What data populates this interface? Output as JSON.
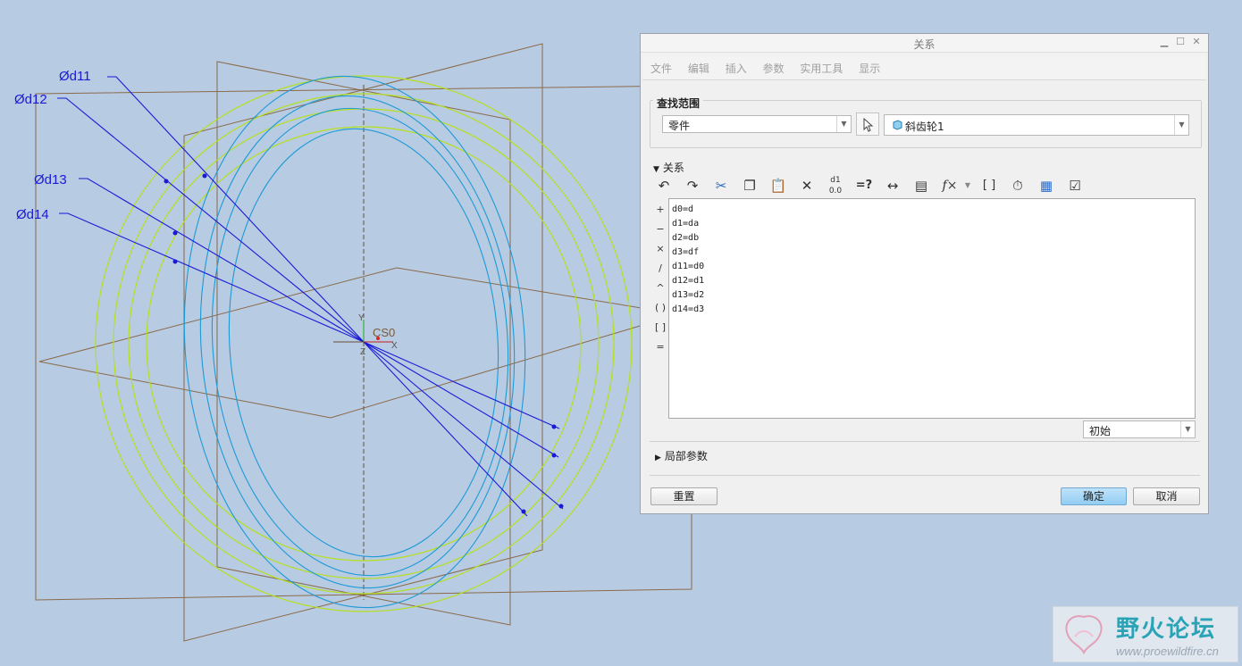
{
  "viewport": {
    "dimensions": [
      "Ød11",
      "Ød12",
      "Ød13",
      "Ød14"
    ],
    "cs_label": "CS0",
    "axis_x": "X",
    "axis_y": "Y",
    "axis_z": "Z"
  },
  "dialog": {
    "title": "关系",
    "menu": [
      "文件",
      "编辑",
      "插入",
      "参数",
      "实用工具",
      "显示"
    ],
    "scope_label": "查找范围",
    "scope_type": "零件",
    "scope_object": "斜齿轮1",
    "relations_label": "关系",
    "operators": [
      "+",
      "−",
      "×",
      "/",
      "^",
      "( )",
      "[ ]",
      "="
    ],
    "relations": [
      "d0=d",
      "d1=da",
      "d2=db",
      "d3=df",
      "d11=d0",
      "d12=d1",
      "d13=d2",
      "d14=d3"
    ],
    "units_select": "初始",
    "local_params_label": "局部参数",
    "reset_label": "重置",
    "ok_label": "确定",
    "cancel_label": "取消",
    "toolbar_text": {
      "params": "d1",
      "eval": "=?",
      "fx": "f×",
      "brackets": "[ ]"
    }
  },
  "watermark": {
    "title": "野火论坛",
    "url": "www.proewildfire.cn"
  },
  "colors": {
    "background": "#b7cbe3",
    "dimension": "#1a1ad6",
    "cyan_curves": "#1e9ad6",
    "green_curves": "#b6e01e",
    "datum_planes": "#8a6a4a"
  }
}
